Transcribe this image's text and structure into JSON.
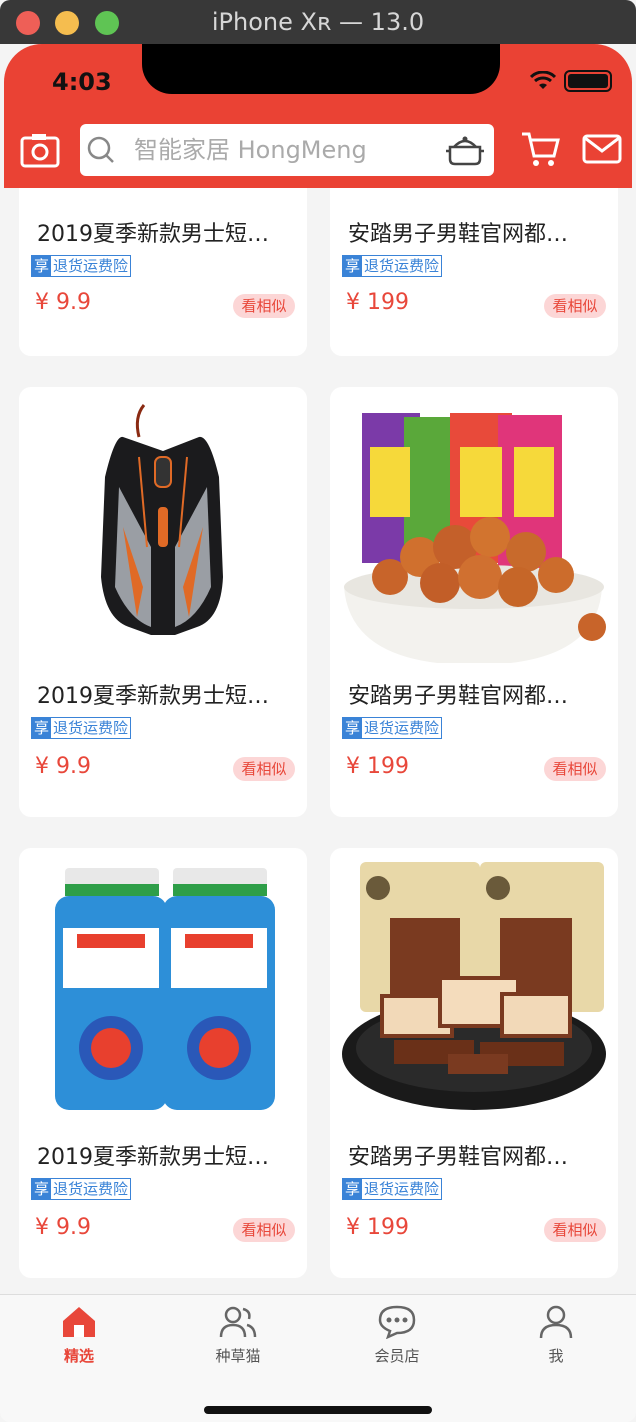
{
  "window": {
    "title": "iPhone Xʀ — 13.0"
  },
  "status": {
    "time": "4:03"
  },
  "search": {
    "placeholder": "智能家居 HongMeng"
  },
  "colors": {
    "brand": "#ea4234",
    "price": "#e8473a",
    "tag": "#3a83d7"
  },
  "products": [
    {
      "title": "2019夏季新款男士短…",
      "tag_mark": "享",
      "tag_text": "退货运费险",
      "price": "¥ 9.9",
      "similar": "看相似",
      "image": "product-image"
    },
    {
      "title": "安踏男子男鞋官网都…",
      "tag_mark": "享",
      "tag_text": "退货运费险",
      "price": "¥ 199",
      "similar": "看相似",
      "image": "product-image"
    },
    {
      "title": "2019夏季新款男士短…",
      "tag_mark": "享",
      "tag_text": "退货运费险",
      "price": "¥ 9.9",
      "similar": "看相似",
      "image": "gaming-mouse-image"
    },
    {
      "title": "安踏男子男鞋官网都…",
      "tag_mark": "享",
      "tag_text": "退货运费险",
      "price": "¥ 199",
      "similar": "看相似",
      "image": "snack-peanuts-image"
    },
    {
      "title": "2019夏季新款男士短…",
      "tag_mark": "享",
      "tag_text": "退货运费险",
      "price": "¥ 9.9",
      "similar": "看相似",
      "image": "calcium-tablets-image"
    },
    {
      "title": "安踏男子男鞋官网都…",
      "tag_mark": "享",
      "tag_text": "退货运费险",
      "price": "¥ 199",
      "similar": "看相似",
      "image": "dried-tofu-image"
    }
  ],
  "tabs": [
    {
      "label": "精选",
      "icon": "home-icon",
      "active": true
    },
    {
      "label": "种草猫",
      "icon": "friends-icon",
      "active": false
    },
    {
      "label": "会员店",
      "icon": "chat-icon",
      "active": false
    },
    {
      "label": "我",
      "icon": "person-icon",
      "active": false
    }
  ]
}
